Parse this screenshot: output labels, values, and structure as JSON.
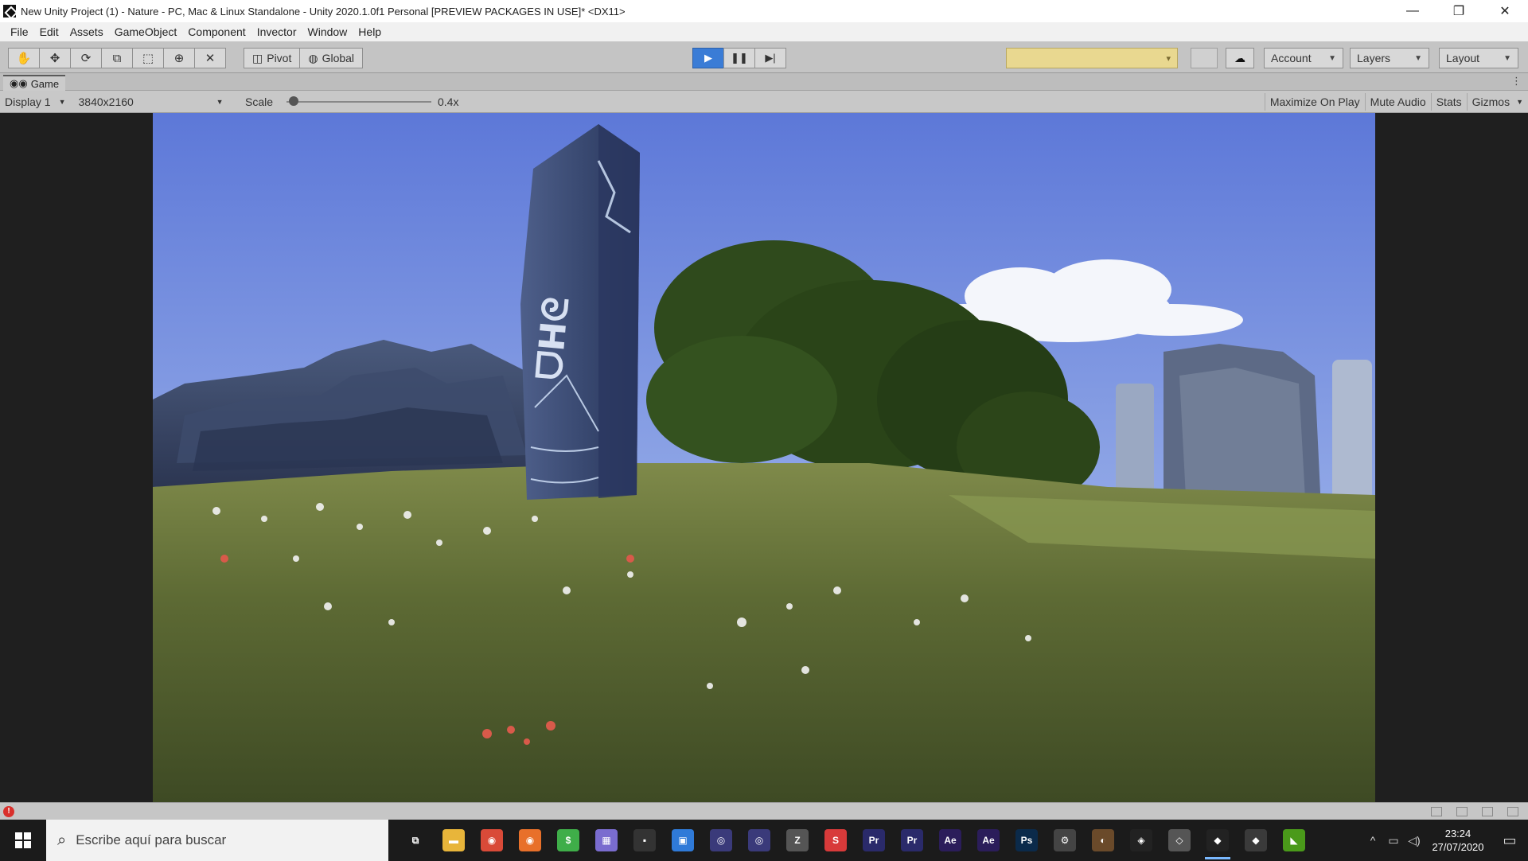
{
  "window": {
    "title": "New Unity Project (1) - Nature - PC, Mac & Linux Standalone - Unity 2020.1.0f1 Personal [PREVIEW PACKAGES IN USE]* <DX11>",
    "controls": {
      "minimize": "—",
      "maximize": "❐",
      "close": "✕"
    }
  },
  "menu": [
    "File",
    "Edit",
    "Assets",
    "GameObject",
    "Component",
    "Invector",
    "Window",
    "Help"
  ],
  "toolbar": {
    "transform_tools": [
      {
        "name": "hand-tool",
        "glyph": "✋"
      },
      {
        "name": "move-tool",
        "glyph": "✥"
      },
      {
        "name": "rotate-tool",
        "glyph": "⟳"
      },
      {
        "name": "scale-tool",
        "glyph": "⧉"
      },
      {
        "name": "rect-tool",
        "glyph": "⬚"
      },
      {
        "name": "transform-tool",
        "glyph": "⊕"
      },
      {
        "name": "custom-tool",
        "glyph": "✕"
      }
    ],
    "pivot_label": "Pivot",
    "global_label": "Global",
    "play": {
      "play": "▶",
      "pause": "❚❚",
      "step": "▶|"
    },
    "account_label": "Account",
    "layers_label": "Layers",
    "layout_label": "Layout"
  },
  "game_tab": {
    "label": "Game"
  },
  "game_toolbar": {
    "display": "Display 1",
    "resolution": "3840x2160",
    "scale_label": "Scale",
    "scale_value": "0.4x",
    "scale_fraction": 0.05,
    "maximize_on_play": "Maximize On Play",
    "mute_audio": "Mute Audio",
    "stats": "Stats",
    "gizmos": "Gizmos"
  },
  "status": {
    "error_icon": "!"
  },
  "taskbar": {
    "search_placeholder": "Escribe aquí para buscar",
    "apps": [
      {
        "name": "task-view-icon",
        "label": "⧉",
        "bg": "transparent"
      },
      {
        "name": "file-explorer-icon",
        "label": "▬",
        "bg": "#e8b53a"
      },
      {
        "name": "chrome-icon",
        "label": "◉",
        "bg": "#d94a38"
      },
      {
        "name": "firefox-icon",
        "label": "◉",
        "bg": "#e8702a"
      },
      {
        "name": "green-app-icon",
        "label": "$",
        "bg": "#3fae49"
      },
      {
        "name": "purple-app-icon",
        "label": "▦",
        "bg": "#7a6ccf"
      },
      {
        "name": "dark-app-icon",
        "label": "▪",
        "bg": "#333333"
      },
      {
        "name": "photo-app-icon",
        "label": "▣",
        "bg": "#2f7ad8"
      },
      {
        "name": "obs-icon",
        "label": "◎",
        "bg": "#3a3a7a"
      },
      {
        "name": "obs2-icon",
        "label": "◎",
        "bg": "#3a3a7a"
      },
      {
        "name": "zbrush-icon",
        "label": "Z",
        "bg": "#555555"
      },
      {
        "name": "red-app-icon",
        "label": "S",
        "bg": "#d83a3a"
      },
      {
        "name": "premiere-icon",
        "label": "Pr",
        "bg": "#2a2a6a"
      },
      {
        "name": "premiere2-icon",
        "label": "Pr",
        "bg": "#2a2a6a"
      },
      {
        "name": "after-effects-icon",
        "label": "Ae",
        "bg": "#2b1d5a"
      },
      {
        "name": "after-effects2-icon",
        "label": "Ae",
        "bg": "#2b1d5a"
      },
      {
        "name": "photoshop-icon",
        "label": "Ps",
        "bg": "#0b2a4a"
      },
      {
        "name": "gear-app-icon",
        "label": "⚙",
        "bg": "#444444"
      },
      {
        "name": "blender-icon",
        "label": "◐",
        "bg": "#6a4a2a"
      },
      {
        "name": "davinci-icon",
        "label": "◈",
        "bg": "#222222"
      },
      {
        "name": "vs-code-icon",
        "label": "◇",
        "bg": "#555555"
      },
      {
        "name": "unity-taskbar-icon",
        "label": "◆",
        "bg": "#222222"
      },
      {
        "name": "unity-hub-icon",
        "label": "◆",
        "bg": "#3a3a3a"
      },
      {
        "name": "nvidia-icon",
        "label": "◣",
        "bg": "#4a9a1a"
      }
    ],
    "active_index": 21,
    "tray_icons": [
      "^",
      "▭",
      "◁)"
    ],
    "time": "23:24",
    "date": "27/07/2020",
    "notification_glyph": "▭"
  },
  "colors": {
    "accent_play": "#3a7cd6",
    "collab_yellow": "#e9d890",
    "error_red": "#d9302c"
  }
}
